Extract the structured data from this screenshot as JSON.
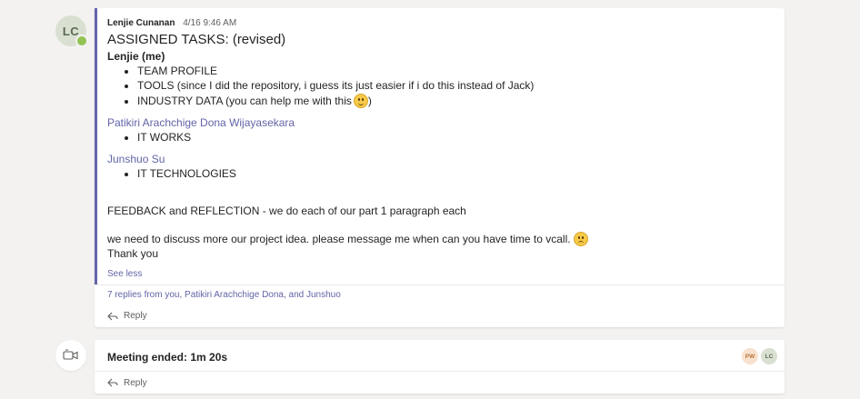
{
  "message": {
    "avatar_initials": "LC",
    "author": "Lenjie Cunanan",
    "timestamp": "4/16 9:46 AM",
    "subject": "ASSIGNED TASKS: (revised)",
    "section1_title": "Lenjie (me)",
    "section1_items": [
      "TEAM PROFILE",
      "TOOLS (since I did the repository, i guess its just easier if i do this instead of Jack)",
      "INDUSTRY DATA (you can help me with this",
      ")"
    ],
    "section2_mention": "Patikiri Arachchige Dona Wijayasekara",
    "section2_items": [
      "IT WORKS"
    ],
    "section3_mention": "Junshuo Su",
    "section3_items": [
      "IT TECHNOLOGIES"
    ],
    "feedback_line": "FEEDBACK and REFLECTION - we do each of our part 1 paragraph each",
    "discuss_line": "we need to discuss more our project idea. please message me when can you have time to vcall.",
    "thanks_line": "Thank you",
    "see_less": "See less",
    "replies_summary": "7 replies from you, Patikiri Arachchige Dona, and Junshuo",
    "reply_label": "Reply"
  },
  "meeting": {
    "text": "Meeting ended: 1m 20s",
    "participants": [
      {
        "initials": "PW",
        "bg": "#f8e2cf",
        "fg": "#b8733a"
      },
      {
        "initials": "LC",
        "bg": "#d9e0d2",
        "fg": "#5a6b52"
      }
    ],
    "reply_label": "Reply"
  },
  "colors": {
    "accent": "#6264a7",
    "presence": "#92c353",
    "background": "#f3f2f1"
  },
  "icons": [
    "smile-emoji-icon",
    "sad-emoji-icon",
    "reply-arrow-icon",
    "meeting-camera-icon"
  ]
}
